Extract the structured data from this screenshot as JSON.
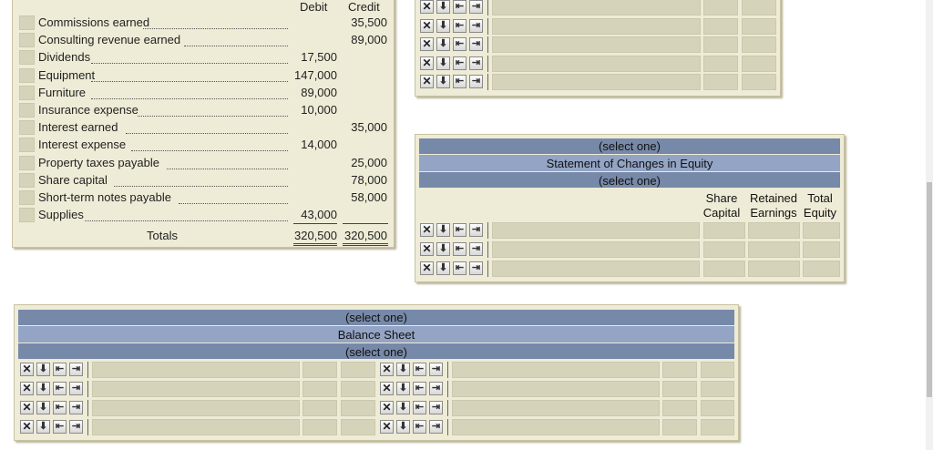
{
  "trial_balance": {
    "header_debit": "Debit",
    "header_credit": "Credit",
    "rows": [
      {
        "account": "Commissions earned",
        "debit": "",
        "credit": "35,500"
      },
      {
        "account": "Consulting revenue earned",
        "debit": "",
        "credit": "89,000"
      },
      {
        "account": "Dividends",
        "debit": "17,500",
        "credit": ""
      },
      {
        "account": "Equipment",
        "debit": "147,000",
        "credit": ""
      },
      {
        "account": "Furniture",
        "debit": "89,000",
        "credit": ""
      },
      {
        "account": "Insurance expense",
        "debit": "10,000",
        "credit": ""
      },
      {
        "account": "Interest earned",
        "debit": "",
        "credit": "35,000"
      },
      {
        "account": "Interest expense",
        "debit": "14,000",
        "credit": ""
      },
      {
        "account": "Property taxes payable",
        "debit": "",
        "credit": "25,000"
      },
      {
        "account": "Share capital",
        "debit": "",
        "credit": "78,000"
      },
      {
        "account": "Short-term notes payable",
        "debit": "",
        "credit": "58,000"
      },
      {
        "account": "Supplies",
        "debit": "43,000",
        "credit": ""
      }
    ],
    "totals_label": "Totals",
    "totals_debit": "320,500",
    "totals_credit": "320,500"
  },
  "equity_statement": {
    "select_top": "(select one)",
    "title": "Statement of Changes in Equity",
    "select_bottom": "(select one)",
    "col_share": "Share\nCapital",
    "col_retained": "Retained\nEarnings",
    "col_total": "Total\nEquity",
    "col_share_1": "Share",
    "col_share_2": "Capital",
    "col_retained_1": "Retained",
    "col_retained_2": "Earnings",
    "col_total_1": "Total",
    "col_total_2": "Equity"
  },
  "balance_sheet": {
    "select_top": "(select one)",
    "title": "Balance Sheet",
    "select_bottom": "(select one)"
  },
  "toolbar_icons": [
    "delete-row-icon",
    "insert-row-below-icon",
    "outdent-icon",
    "indent-icon"
  ],
  "toolbar_glyphs": {
    "delete": "✕",
    "insert": "⬇",
    "outdent": "⇤",
    "indent": "⇥"
  }
}
